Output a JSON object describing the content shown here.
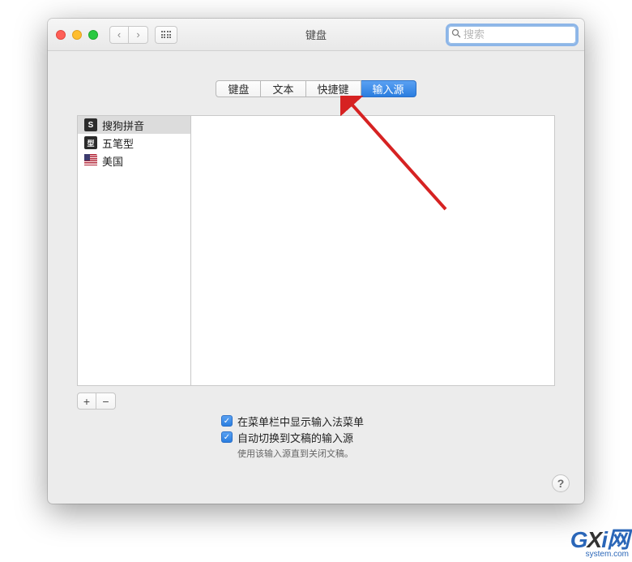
{
  "window": {
    "title": "键盘",
    "search_placeholder": "搜索"
  },
  "tabs": [
    {
      "label": "键盘",
      "active": false
    },
    {
      "label": "文本",
      "active": false
    },
    {
      "label": "快捷键",
      "active": false
    },
    {
      "label": "输入源",
      "active": true
    }
  ],
  "sources": [
    {
      "icon": "S",
      "label": "搜狗拼音",
      "selected": true,
      "type": "sogou"
    },
    {
      "icon": "型",
      "label": "五笔型",
      "selected": false,
      "type": "wubi"
    },
    {
      "icon": "",
      "label": "美国",
      "selected": false,
      "type": "usa"
    }
  ],
  "buttons": {
    "add": "+",
    "remove": "−",
    "help": "?"
  },
  "options": {
    "show_menu": {
      "checked": true,
      "label": "在菜单栏中显示输入法菜单"
    },
    "auto_switch": {
      "checked": true,
      "label": "自动切换到文稿的输入源"
    },
    "hint": "使用该输入源直到关闭文稿。"
  },
  "watermark": {
    "brand_g": "G",
    "brand_x": "X",
    "brand_i": "i",
    "brand_net": "网",
    "url": "system.com"
  }
}
